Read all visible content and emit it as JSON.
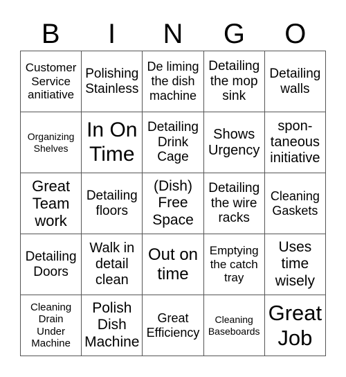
{
  "header": [
    "B",
    "I",
    "N",
    "G",
    "O"
  ],
  "cells": [
    "Customer\nService\nanitiative",
    "Polishing\nStainless",
    "De liming\nthe dish\nmachine",
    "Detailing\nthe mop\nsink",
    "Detailing\nwalls",
    "Organizing\nShelves",
    "In On\nTime",
    "Detailing\nDrink\nCage",
    "Shows\nUrgency",
    "spon-\ntaneous\ninitiative",
    "Great\nTeam\nwork",
    "Detailing\nfloors",
    "(Dish)\nFree\nSpace",
    "Detailing\nthe wire\nracks",
    "Cleaning\nGaskets",
    "Detailing\nDoors",
    "Walk in\ndetail\nclean",
    "Out on\ntime",
    "Emptying\nthe catch\ntray",
    "Uses\ntime\nwisely",
    "Cleaning\nDrain\nUnder\nMachine",
    "Polish\nDish\nMachine",
    "Great\nEfficiency",
    "Cleaning\nBaseboards",
    "Great\nJob"
  ]
}
